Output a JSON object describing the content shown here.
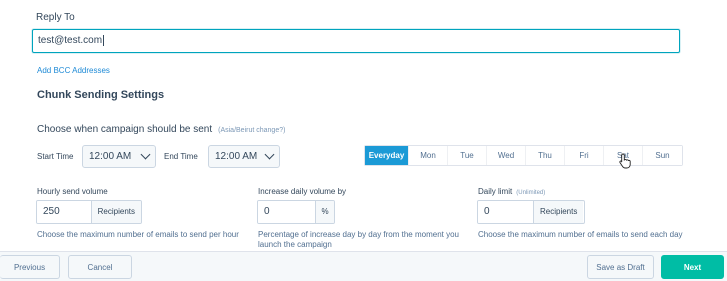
{
  "reply_to": {
    "label": "Reply To",
    "value": "test@test.com"
  },
  "add_bcc_link": "Add BCC Addresses",
  "chunk_heading": "Chunk Sending Settings",
  "schedule": {
    "title": "Choose when campaign should be sent",
    "timezone_link": "(Asia/Beirut change?)",
    "start_label": "Start Time",
    "start_value": "12:00 AM",
    "end_label": "End Time",
    "end_value": "12:00 AM",
    "days": [
      "Everyday",
      "Mon",
      "Tue",
      "Wed",
      "Thu",
      "Fri",
      "Sat",
      "Sun"
    ],
    "selected_day": "Everyday"
  },
  "hourly": {
    "label": "Hourly send volume",
    "value": "250",
    "suffix": "Recipients",
    "help": "Choose the maximum number of emails to send per hour"
  },
  "increase": {
    "label": "Increase daily volume by",
    "value": "0",
    "suffix": "%",
    "help": "Percentage of increase day by day from the moment you launch the campaign"
  },
  "daily_limit": {
    "label": "Daily limit",
    "note": "(Unlimited)",
    "value": "0",
    "suffix": "Recipients",
    "help": "Choose the maximum number of emails to send each day"
  },
  "footer": {
    "previous": "Previous",
    "cancel": "Cancel",
    "save_draft": "Save as Draft",
    "next": "Next"
  },
  "colors": {
    "accent": "#1b9ad6",
    "primary_button": "#00bda5",
    "focus_border": "#00a4bd"
  }
}
